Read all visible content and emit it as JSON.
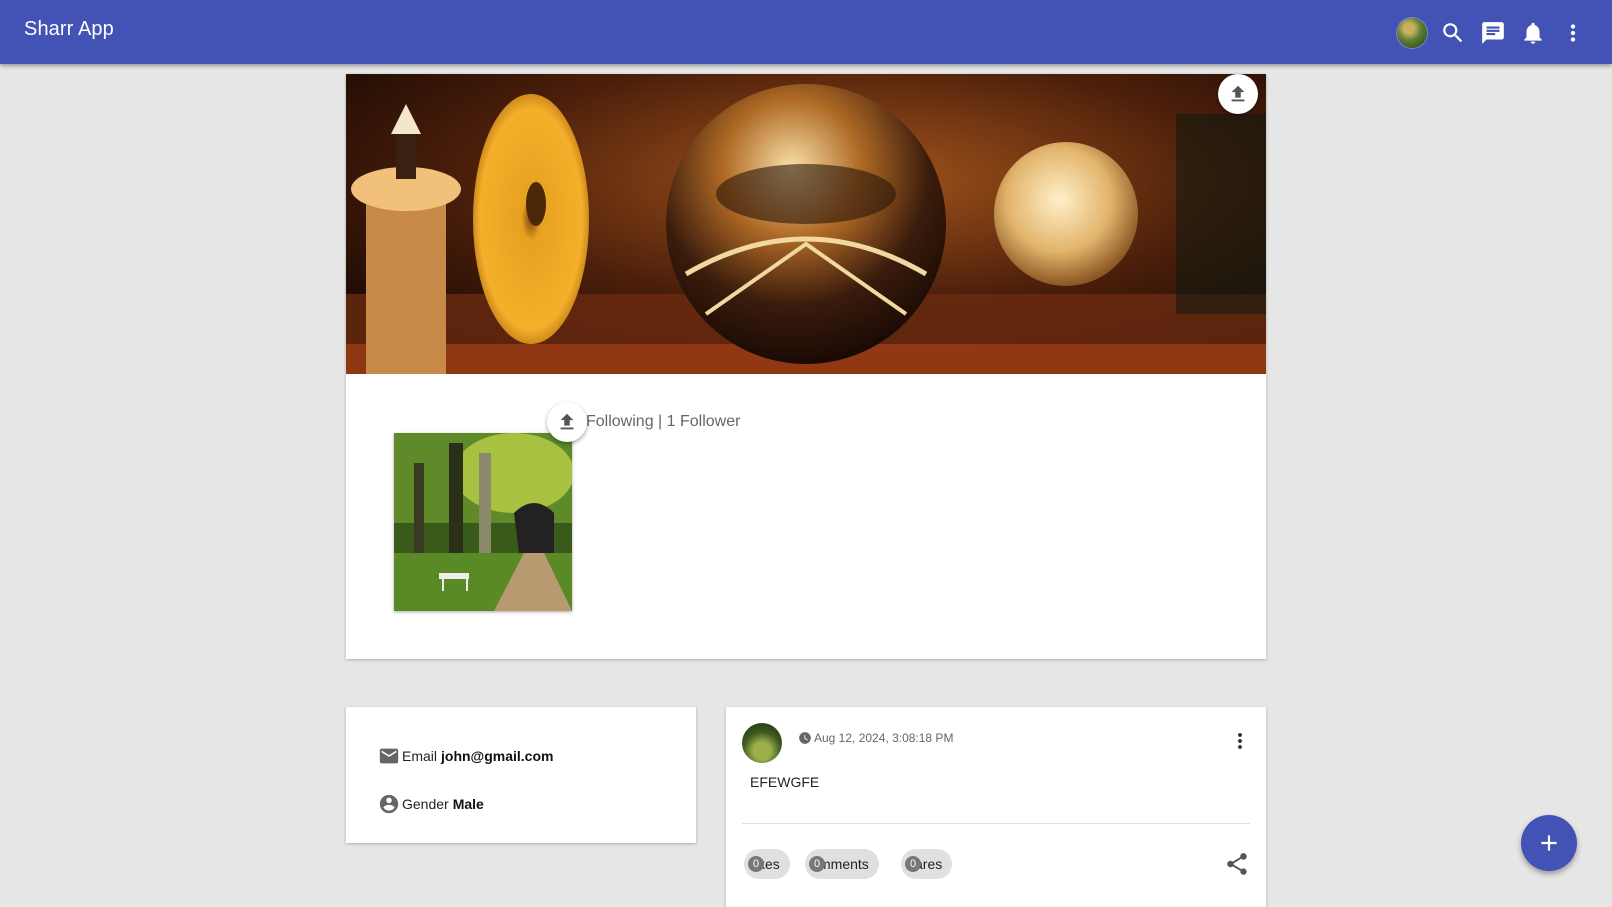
{
  "appbar": {
    "title": "Sharr App",
    "icons": [
      "avatar",
      "search-icon",
      "chat-icon",
      "notifications-icon",
      "more-vert-icon"
    ],
    "color": "#4353b5"
  },
  "profile": {
    "follow_text": "Following | 1 Follower"
  },
  "info": {
    "email_label": "Email",
    "email_value": "john@gmail.com",
    "gender_label": "Gender",
    "gender_value": "Male"
  },
  "post": {
    "timestamp": "Aug 12, 2024, 3:08:18 PM",
    "text": "EFEWGFE",
    "chips": [
      {
        "count": "0",
        "label": "kes"
      },
      {
        "count": "0",
        "label": "mments"
      },
      {
        "count": "0",
        "label": "ares"
      }
    ]
  }
}
